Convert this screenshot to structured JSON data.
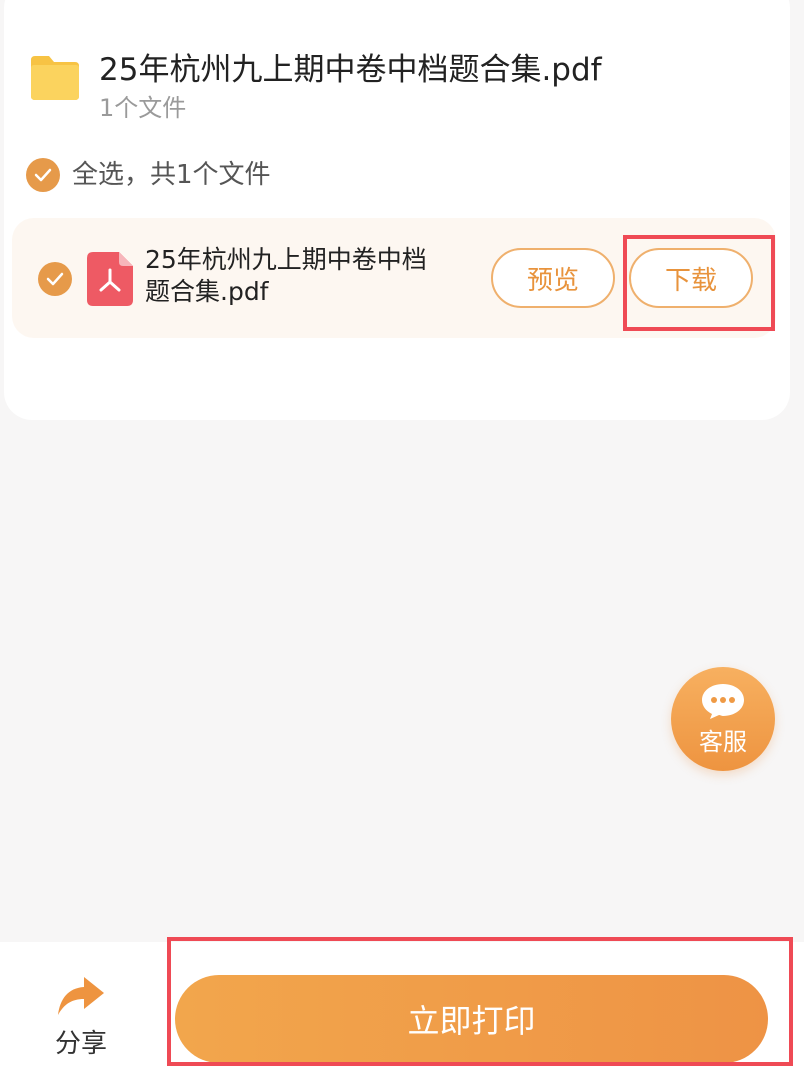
{
  "folder": {
    "title": "25年杭州九上期中卷中档题合集.pdf",
    "file_count": "1个文件",
    "icon": "folder-icon"
  },
  "select_all": {
    "label": "全选，共1个文件",
    "checked": true
  },
  "files": [
    {
      "name": "25年杭州九上期中卷中档题合集.pdf",
      "checked": true,
      "icon": "pdf-icon",
      "preview_label": "预览",
      "download_label": "下载"
    }
  ],
  "customer_service": {
    "label": "客服",
    "icon": "chat-bubble-icon"
  },
  "bottom_bar": {
    "share_label": "分享",
    "share_icon": "share-arrow-icon",
    "print_label": "立即打印"
  },
  "colors": {
    "accent": "#ee9a47",
    "highlight": "#ef4a55",
    "pdf": "#ee5a64",
    "folder": "#f8cc4f"
  }
}
